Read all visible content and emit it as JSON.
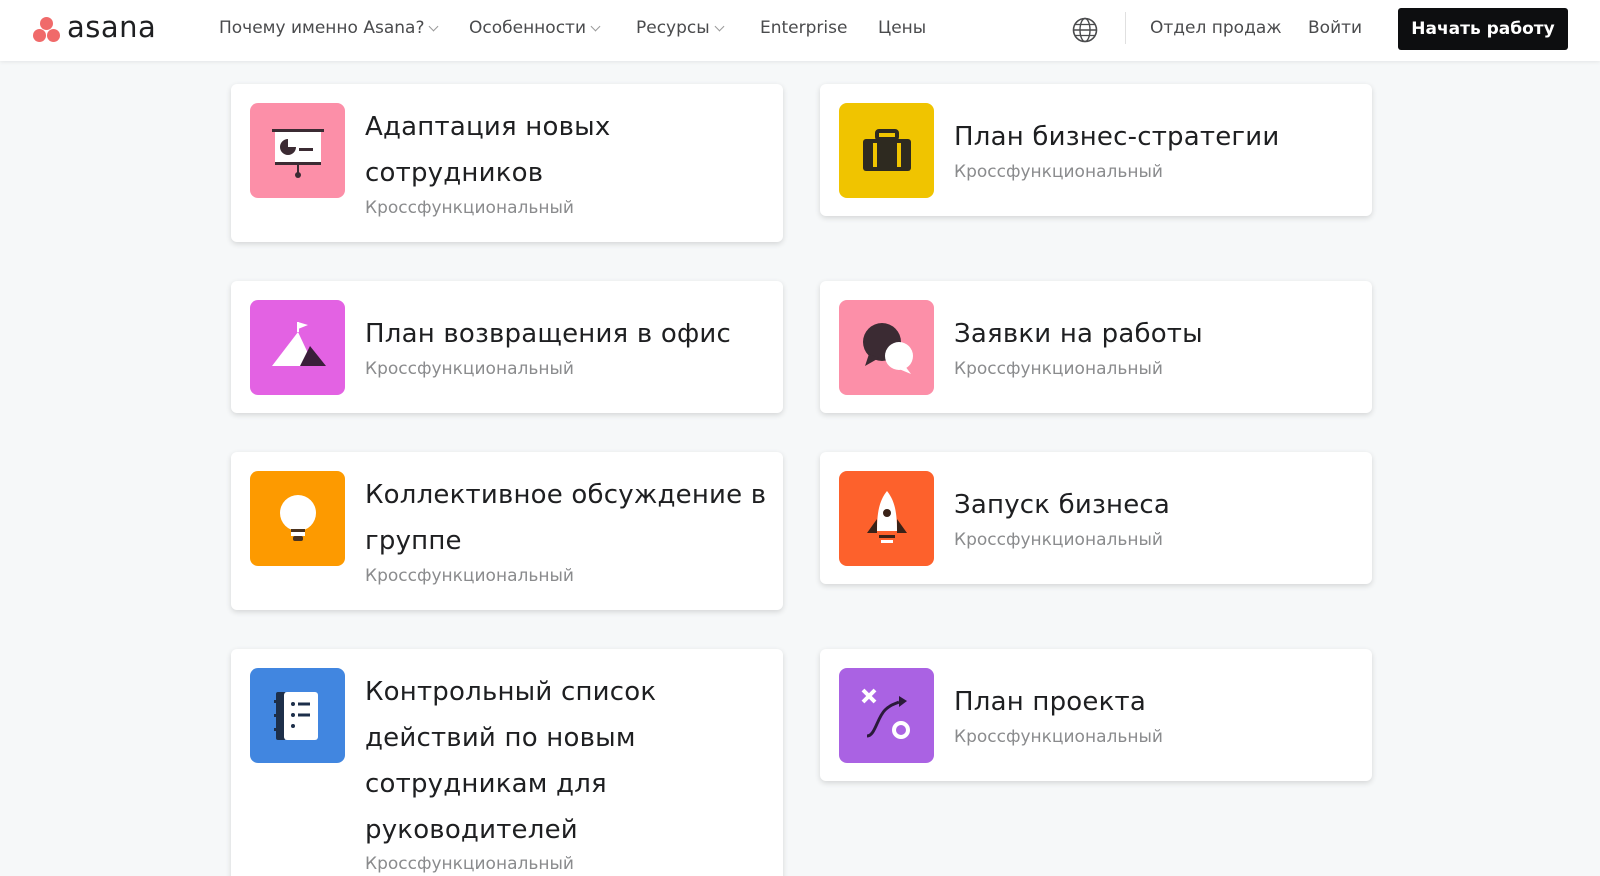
{
  "header": {
    "logo_text": "asana",
    "nav": [
      {
        "label": "Почему именно Asana?",
        "dropdown": true
      },
      {
        "label": "Особенности",
        "dropdown": true
      },
      {
        "label": "Ресурсы",
        "dropdown": true
      },
      {
        "label": "Enterprise",
        "dropdown": false
      },
      {
        "label": "Цены",
        "dropdown": false
      }
    ],
    "globe_icon": "globe-icon",
    "sales_link": "Отдел продаж",
    "login_link": "Войти",
    "cta_label": "Начать работу"
  },
  "cards": [
    {
      "title_lines": [
        "Адаптация новых",
        "сотрудников"
      ],
      "subtitle": "Кроссфункциональный",
      "icon": "presentation-icon",
      "color": "#fc8fa8"
    },
    {
      "title_lines": [
        "План бизнес-стратегии"
      ],
      "subtitle": "Кроссфункциональный",
      "icon": "briefcase-icon",
      "color": "#f0c400"
    },
    {
      "title_lines": [
        "План возвращения в офис"
      ],
      "subtitle": "Кроссфункциональный",
      "icon": "mountain-flag-icon",
      "color": "#e362e3"
    },
    {
      "title_lines": [
        "Заявки на работы"
      ],
      "subtitle": "Кроссфункциональный",
      "icon": "chat-bubbles-icon",
      "color": "#fc8fa8"
    },
    {
      "title_lines": [
        "Коллективное обсуждение в",
        "группе"
      ],
      "subtitle": "Кроссфункциональный",
      "icon": "lightbulb-icon",
      "color": "#fd9a00"
    },
    {
      "title_lines": [
        "Запуск бизнеса"
      ],
      "subtitle": "Кроссфункциональный",
      "icon": "rocket-icon",
      "color": "#fd612c"
    },
    {
      "title_lines": [
        "Контрольный список",
        "действий по новым",
        "сотрудникам для",
        "руководителей"
      ],
      "subtitle": "Кроссфункциональный",
      "icon": "notebook-icon",
      "color": "#4186e0"
    },
    {
      "title_lines": [
        "План проекта"
      ],
      "subtitle": "Кроссфункциональный",
      "icon": "strategy-path-icon",
      "color": "#aa62e3"
    }
  ]
}
